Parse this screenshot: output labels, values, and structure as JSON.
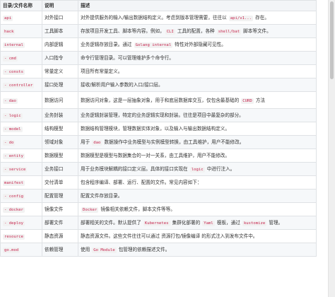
{
  "headers": [
    "目录/文件名称",
    "说明",
    "描述"
  ],
  "rows": [
    {
      "name": "api",
      "desc": "对外接口",
      "detail": [
        {
          "t": "对外提供服务的输入/输出数据结构定义。考虑到版本管理需要，往往以 "
        },
        {
          "c": "api/v1..."
        },
        {
          "t": " 存在。"
        }
      ]
    },
    {
      "name": "hack",
      "desc": "工具脚本",
      "detail": [
        {
          "t": "存放项目开发工具、脚本等内容。例如，"
        },
        {
          "c": "CLI"
        },
        {
          "t": " 工具的配置，各种 "
        },
        {
          "c": "shell/bat"
        },
        {
          "t": " 脚本等文件。"
        }
      ]
    },
    {
      "name": "internal",
      "desc": "内部逻辑",
      "detail": [
        {
          "t": "业务逻辑存放目录。通过 "
        },
        {
          "c": "Golang internal"
        },
        {
          "t": " 特性对外部隐藏可见性。"
        }
      ]
    },
    {
      "name": "- cmd",
      "desc": "入口指令",
      "detail": [
        {
          "t": "命令行管理目录。可以管理维护多个命令行。"
        }
      ]
    },
    {
      "name": "- consts",
      "desc": "常量定义",
      "detail": [
        {
          "t": "项目所有常量定义。"
        }
      ]
    },
    {
      "name": "- controller",
      "desc": "接口处理",
      "detail": [
        {
          "t": "接收/解析用户输入参数的入口/接口层。"
        }
      ]
    },
    {
      "name": "- dao",
      "desc": "数据访问",
      "detail": [
        {
          "t": "数据访问对象，这是一层抽象对象，用于和底层数据库交互，仅包含最基础的 "
        },
        {
          "c": "CURD"
        },
        {
          "t": " 方法"
        }
      ],
      "double": true
    },
    {
      "name": "- logic",
      "desc": "业务封装",
      "detail": [
        {
          "t": "业务逻辑封装管理，特定的业务逻辑实现和封装。往往是项目中最复杂的部分。"
        }
      ]
    },
    {
      "name": "- model",
      "desc": "结构模型",
      "detail": [
        {
          "t": "数据结构管理模块，管理数据实体对象，以及输入与输出数据结构定义。"
        }
      ]
    },
    {
      "name": "- do",
      "desc": "领域对象",
      "detail": [
        {
          "t": "用于 "
        },
        {
          "c": "dao"
        },
        {
          "t": " 数据操作中业务模型与实例模型转换，由工具维护，用户不能修改。"
        }
      ]
    },
    {
      "name": "- entity",
      "desc": "数据模型",
      "detail": [
        {
          "t": "数据模型是模型与数据集合的一对一关系，由工具维护，用户不能修改。"
        }
      ]
    },
    {
      "name": "- service",
      "desc": "业务接口",
      "detail": [
        {
          "t": "用于业务模块解耦的接口定义层。具体的接口实现在 "
        },
        {
          "c": "logic"
        },
        {
          "t": " 中进行注入。"
        }
      ]
    },
    {
      "name": "manifest",
      "desc": "交付清单",
      "detail": [
        {
          "t": "包含程序编译、部署、运行、配置的文件。常见内容如下："
        }
      ]
    },
    {
      "name": "- config",
      "desc": "配置管理",
      "detail": [
        {
          "t": "配置文件存放目录。"
        }
      ]
    },
    {
      "name": "- docker",
      "desc": "镜像文件",
      "detail": [
        {
          "c": "Docker"
        },
        {
          "t": " 镜像相关依赖文件，脚本文件等等。"
        }
      ]
    },
    {
      "name": "- deploy",
      "desc": "部署文件",
      "detail": [
        {
          "t": "部署相关的文件。默认提供了 "
        },
        {
          "c": "Kubernetes"
        },
        {
          "t": " 集群化部署的 "
        },
        {
          "c": "Yaml"
        },
        {
          "t": " 模板，通过 "
        },
        {
          "c": "kustomize"
        },
        {
          "t": " 管理。"
        }
      ]
    },
    {
      "name": "resource",
      "desc": "静态资源",
      "detail": [
        {
          "t": "静态资源文件。这些文件往往可以通过 资源打包/镜像编译 的形式注入到发布文件中。"
        }
      ]
    },
    {
      "name": "go.mod",
      "desc": "依赖管理",
      "detail": [
        {
          "t": "使用 "
        },
        {
          "c": "Go Module"
        },
        {
          "t": " 包管理的依赖描述文件。"
        }
      ]
    }
  ]
}
